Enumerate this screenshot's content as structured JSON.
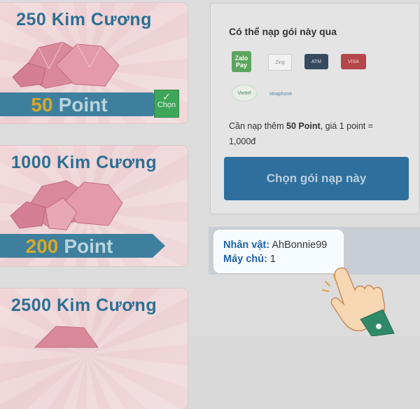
{
  "packages": [
    {
      "title": "250 Kim Cương",
      "points": "50",
      "point_word": "Point",
      "selected_label": "Chọn"
    },
    {
      "title": "1000 Kim Cương",
      "points": "200",
      "point_word": "Point"
    },
    {
      "title": "2500 Kim Cương"
    }
  ],
  "payment": {
    "title": "Có thể nạp gói này qua",
    "methods": [
      "Zalo Pay",
      "Zing",
      "ATM",
      "VISA",
      "Viettel",
      "vinaphone"
    ],
    "need_prefix": "Cần nạp thêm ",
    "need_amount": "50 Point",
    "need_suffix": ", giá 1 point =",
    "rate": "1,000đ",
    "choose_label": "Chọn gói nạp này"
  },
  "character": {
    "name_label": "Nhân vật:",
    "name_value": "AhBonnie99",
    "server_label": "Máy chủ:",
    "server_value": "1"
  },
  "colors": {
    "accent_blue": "#2f6f9d",
    "ribbon": "#3e7f9e",
    "highlight_green": "#3ea65b"
  },
  "icons": [
    "check-icon",
    "hand-pointer-icon"
  ]
}
